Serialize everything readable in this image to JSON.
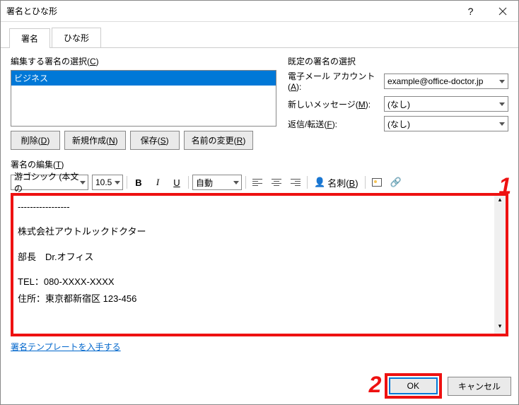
{
  "title": "署名とひな形",
  "tabs": {
    "signature": "署名",
    "template": "ひな形"
  },
  "left": {
    "selectLabelPre": "編集する署名の選択(",
    "selectLabelKey": "C",
    "selectLabelPost": ")",
    "listItem": "ビジネス",
    "buttons": {
      "delete": "削除(D)",
      "new": "新規作成(N)",
      "save": "保存(S)",
      "rename": "名前の変更(R)"
    }
  },
  "right": {
    "header": "既定の署名の選択",
    "accountLabelPre": "電子メール アカウント(",
    "accountLabelKey": "A",
    "accountLabelPost": "):",
    "accountValue": "example@office-doctor.jp",
    "newMsgLabelPre": "新しいメッセージ(",
    "newMsgLabelKey": "M",
    "newMsgLabelPost": "):",
    "newMsgValue": "(なし)",
    "replyLabelPre": "返信/転送(",
    "replyLabelKey": "F",
    "replyLabelPost": "):",
    "replyValue": "(なし)"
  },
  "editLabelPre": "署名の編集(",
  "editLabelKey": "T",
  "editLabelPost": ")",
  "toolbar": {
    "font": "游ゴシック (本文の",
    "size": "10.5",
    "color": "自動",
    "bizcardPre": "名刺(",
    "bizcardKey": "B",
    "bizcardPost": ")"
  },
  "editor": {
    "line1": "-----------------",
    "line2": "株式会社アウトルックドクター",
    "line3": "部長　Dr.オフィス",
    "line4": "TEL：080-XXXX-XXXX",
    "line5": "住所：東京都新宿区 123-456"
  },
  "badge1": "1",
  "badge2": "2",
  "link": "署名テンプレートを入手する",
  "footer": {
    "ok": "OK",
    "cancel": "キャンセル"
  }
}
